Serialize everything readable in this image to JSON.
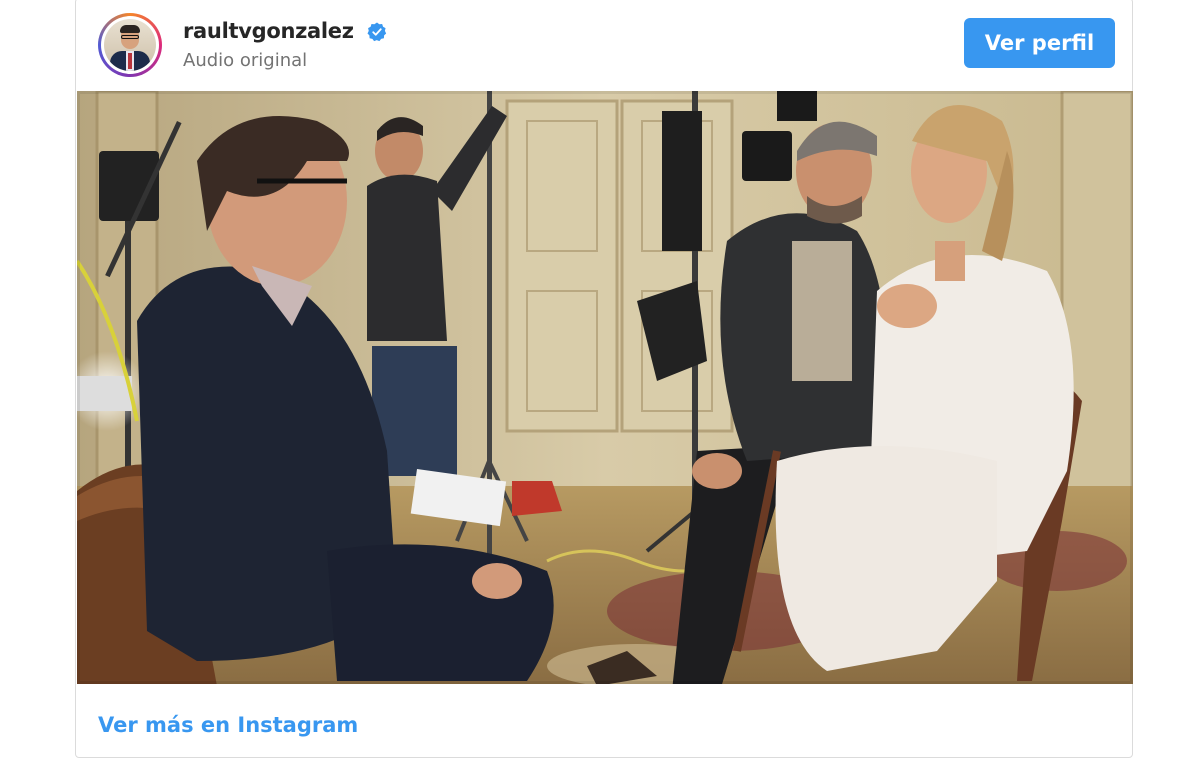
{
  "post": {
    "username": "raultvgonzalez",
    "audio_label": "Audio original",
    "profile_button_label": "Ver perfil",
    "footer_link_label": "Ver más en Instagram",
    "icons": {
      "verified": "verified-badge-icon"
    }
  },
  "colors": {
    "accent": "#3897f0",
    "username": "#262626",
    "subtitle": "#737373"
  }
}
